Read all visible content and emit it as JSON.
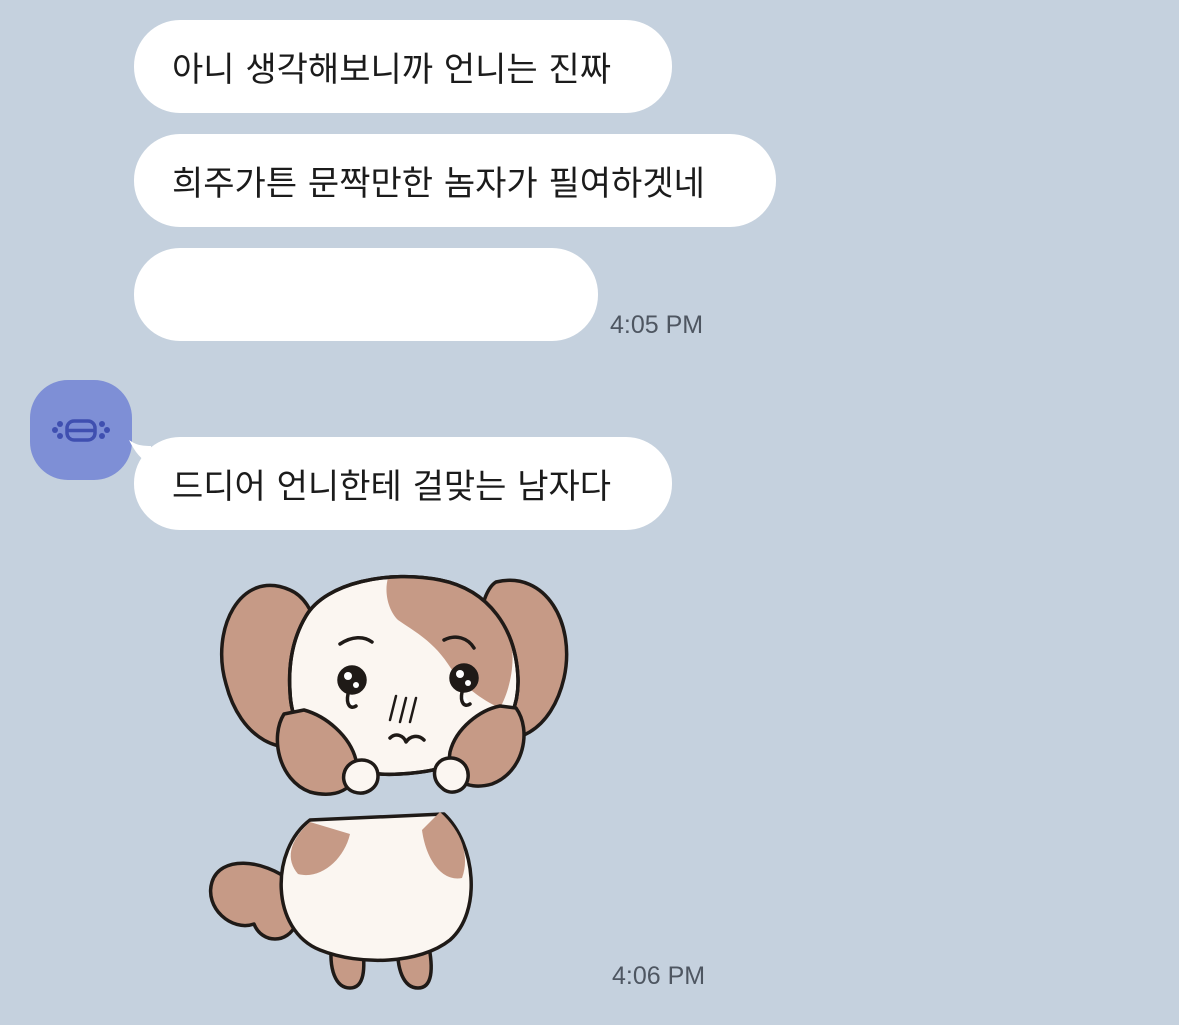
{
  "messages": [
    {
      "text": "아니 생각해보니까 언니는 진짜"
    },
    {
      "text": "희주가튼 문짝만한 놈자가 필여하겟네"
    },
    {
      "text": ""
    },
    {
      "text": "드디어 언니한테 걸맞는 남자다"
    }
  ],
  "timestamps": {
    "first": "4:05 PM",
    "second": "4:06 PM"
  },
  "avatar_icon": "masked-face-icon",
  "sticker_icon": "crying-puppy-sticker",
  "colors": {
    "background": "#c5d1de",
    "bubble": "#ffffff",
    "avatar": "#7e8fd6",
    "timestamp": "#4e5661"
  }
}
